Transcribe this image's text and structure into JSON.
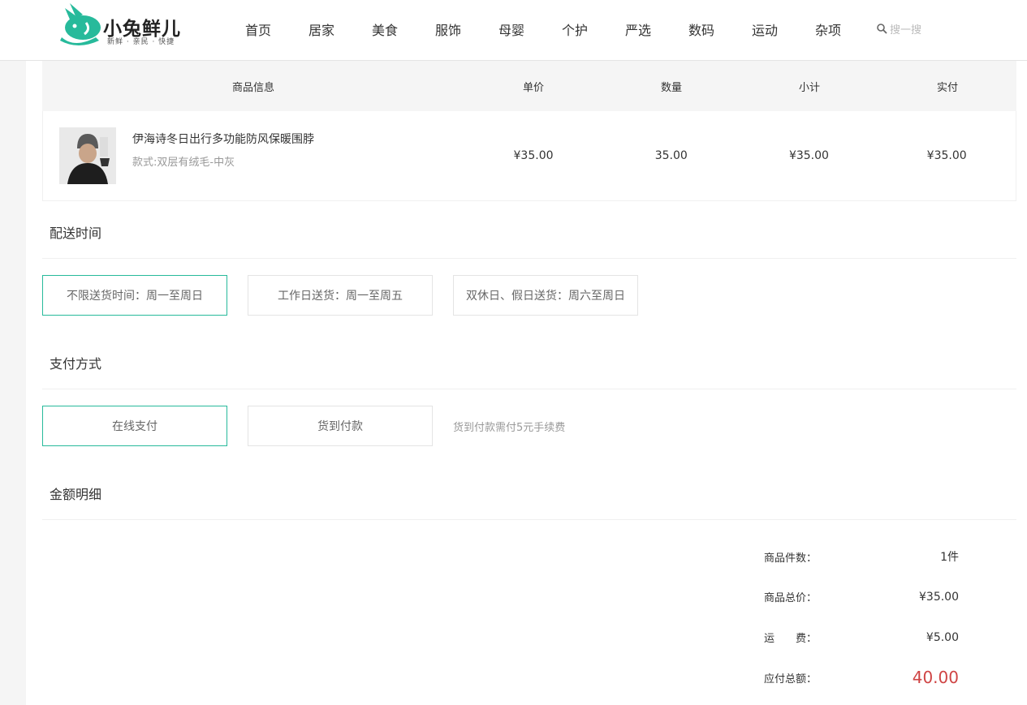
{
  "logo": {
    "title": "小兔鲜儿",
    "subtitle": "新鲜 · 亲民 · 快捷",
    "brand_color": "#27ba9b"
  },
  "nav": {
    "items": [
      "首页",
      "居家",
      "美食",
      "服饰",
      "母婴",
      "个护",
      "严选",
      "数码",
      "运动",
      "杂项"
    ]
  },
  "search": {
    "icon": "search-icon",
    "label": "搜一搜"
  },
  "table": {
    "headers": [
      "商品信息",
      "单价",
      "数量",
      "小计",
      "实付"
    ],
    "rows": [
      {
        "name": "伊海诗冬日出行多功能防风保暖围脖",
        "attrs": "款式:双层有绒毛-中灰",
        "price": "¥35.00",
        "count": "35.00",
        "subtotal": "¥35.00",
        "paid": "¥35.00"
      }
    ]
  },
  "delivery": {
    "title": "配送时间",
    "options": [
      "不限送货时间：周一至周日",
      "工作日送货：周一至周五",
      "双休日、假日送货：周六至周日"
    ],
    "selected_index": 0
  },
  "payment": {
    "title": "支付方式",
    "options": [
      "在线支付",
      "货到付款"
    ],
    "selected_index": 0,
    "tip": "货到付款需付5元手续费"
  },
  "summary": {
    "title": "金额明细",
    "rows": [
      {
        "label": "商品件数：",
        "value": "1件"
      },
      {
        "label": "商品总价：",
        "value": "¥35.00"
      },
      {
        "label": "运　　费：",
        "value": "¥5.00"
      },
      {
        "label": "应付总额：",
        "value": "40.00"
      }
    ]
  },
  "colors": {
    "accent": "#27ba9b",
    "total": "#cf4444"
  }
}
